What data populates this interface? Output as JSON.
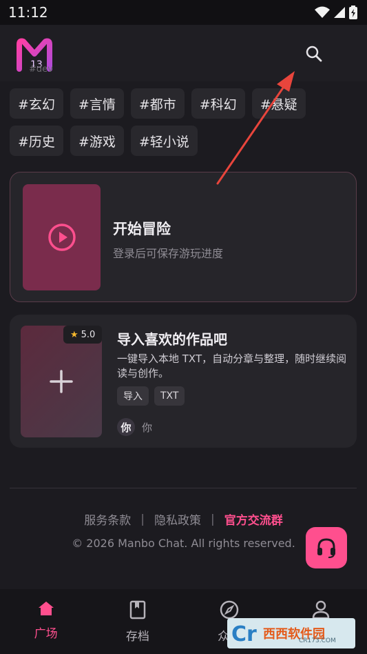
{
  "status_bar": {
    "time": "11:12"
  },
  "header": {
    "logo_tag": "#dev"
  },
  "tags": [
    "#玄幻",
    "#言情",
    "#都市",
    "#科幻",
    "#悬疑",
    "#历史",
    "#游戏",
    "#轻小说"
  ],
  "adventure_card": {
    "title": "开始冒险",
    "subtitle": "登录后可保存游玩进度"
  },
  "import_card": {
    "rating": "5.0",
    "title": "导入喜欢的作品吧",
    "description": "一键导入本地 TXT，自动分章与整理，随时继续阅读与创作。",
    "tags": [
      "导入",
      "TXT"
    ],
    "author_avatar": "你",
    "author_name": "你"
  },
  "footer": {
    "terms": "服务条款",
    "privacy": "隐私政策",
    "group": "官方交流群",
    "separator": "|",
    "copyright": "© 2026 Manbo Chat. All rights reserved."
  },
  "bottom_nav": [
    {
      "label": "广场",
      "icon": "home-icon",
      "active": true
    },
    {
      "label": "存档",
      "icon": "bookmark-icon",
      "active": false
    },
    {
      "label": "众筹",
      "icon": "compass-icon",
      "active": false
    },
    {
      "label": "我的",
      "icon": "person-icon",
      "active": false
    }
  ],
  "watermark": {
    "text": "西西软件园",
    "sub": "CR173.COM"
  },
  "colors": {
    "accent": "#ff4f8e",
    "background": "#1c1b20",
    "card": "#26252a"
  }
}
